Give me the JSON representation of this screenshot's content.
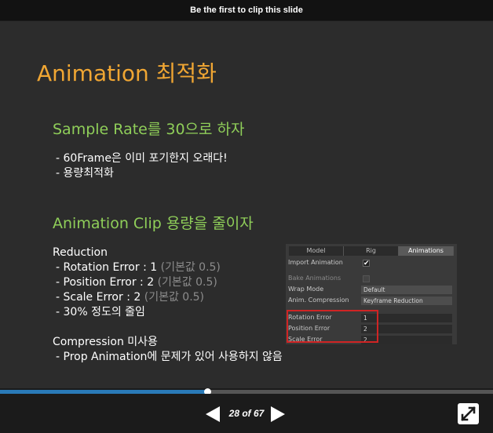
{
  "topbar": {
    "clip_text": "Be the first to clip this slide"
  },
  "slide": {
    "title": "Animation 최적화",
    "section1": {
      "heading": "Sample Rate를 30으로 하자",
      "bullets": [
        "- 60Frame은 이미 포기한지 오래다!",
        "- 용량최적화"
      ]
    },
    "section2": {
      "heading": "Animation Clip 용량을 줄이자",
      "reduction_label": "Reduction",
      "rotation": "- Rotation Error : 1",
      "rotation_default": "(기본값 0.5)",
      "position": "- Position Error : 2",
      "position_default": "(기본값 0.5)",
      "scale": "- Scale Error : 2",
      "scale_default": "(기본값 0.5)",
      "reduce": "- 30% 정도의 줄임",
      "compression_label": "Compression 미사용",
      "compression_note": "- Prop Animation에 문제가 있어 사용하지 않음"
    },
    "inspector": {
      "tabs": [
        "Model",
        "Rig",
        "Animations"
      ],
      "active_tab": "Animations",
      "import_animation": "Import Animation",
      "import_checked": "✔",
      "bake_animations": "Bake Animations",
      "wrap_mode": "Wrap Mode",
      "wrap_value": "Default",
      "anim_compression": "Anim. Compression",
      "compression_value": "Keyframe Reduction",
      "rotation_error": "Rotation Error",
      "rotation_value": "1",
      "position_error": "Position Error",
      "position_value": "2",
      "scale_error": "Scale Error",
      "scale_value": "2"
    }
  },
  "player": {
    "page_info": "28 of 67",
    "progress": 0.42,
    "colors": {
      "progress": "#2a7ab8",
      "title": "#f0a633",
      "heading": "#8fce59"
    }
  }
}
